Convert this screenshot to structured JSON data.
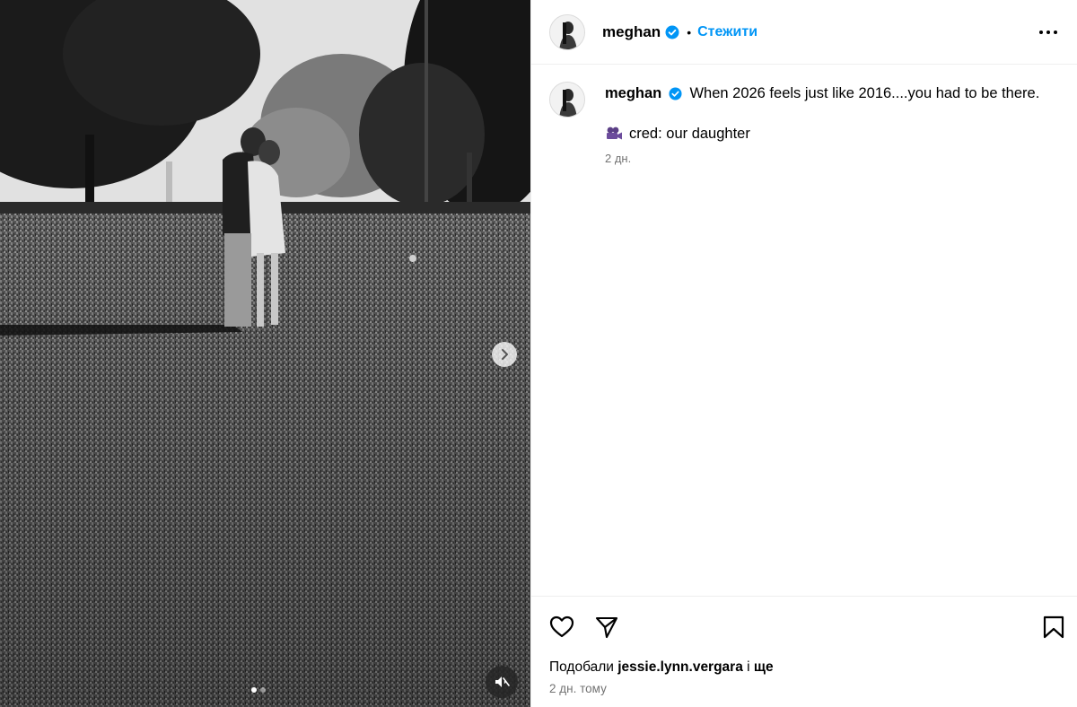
{
  "post": {
    "username": "meghan",
    "follow_label": "Стежити",
    "separator": "•",
    "caption_text": "When 2026 feels just like 2016....you had to be there.",
    "caption_line2_text": "cred: our daughter",
    "caption_line2_emoji": "movie-camera-icon",
    "caption_time": "2 дн.",
    "likes_prefix": "Подобали",
    "likes_user": "jessie.lynn.vergara",
    "likes_conjunction": "і",
    "likes_more": "ще",
    "post_time": "2 дн. тому"
  },
  "carousel": {
    "total_slides": 2,
    "active_slide": 1
  },
  "colors": {
    "accent": "#0095f6",
    "verified": "#0095f6",
    "muted_text": "#737373",
    "divider": "#efefef"
  },
  "icons": [
    "verified-badge-icon",
    "more-options-icon",
    "heart-icon",
    "share-icon",
    "bookmark-icon",
    "chevron-right-icon",
    "muted-speaker-icon",
    "movie-camera-icon"
  ]
}
